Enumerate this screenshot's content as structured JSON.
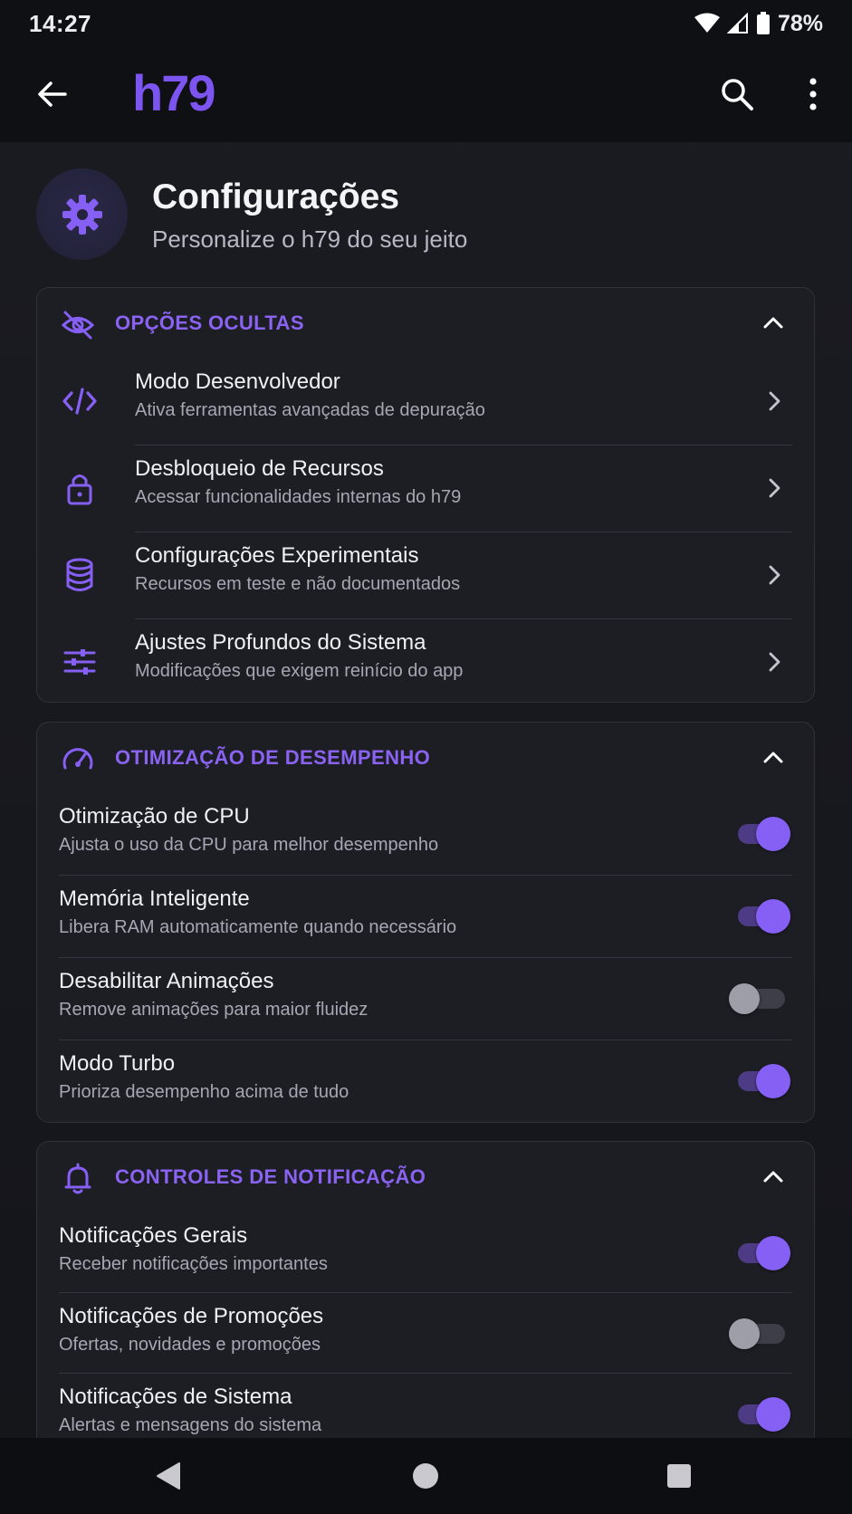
{
  "status": {
    "time": "14:27",
    "battery": "78%"
  },
  "appbar": {
    "logo": "h79"
  },
  "header": {
    "title": "Configurações",
    "subtitle": "Personalize o h79 do seu jeito"
  },
  "hidden_options": {
    "title": "OPÇÕES OCULTAS",
    "items": [
      {
        "label": "Modo Desenvolvedor",
        "desc": "Ativa ferramentas avançadas de depuração",
        "icon": "code-icon"
      },
      {
        "label": "Desbloqueio de Recursos",
        "desc": "Acessar funcionalidades internas do h79",
        "icon": "lock-icon"
      },
      {
        "label": "Configurações Experimentais",
        "desc": "Recursos em teste e não documentados",
        "icon": "database-icon"
      },
      {
        "label": "Ajustes Profundos do Sistema",
        "desc": "Modificações que exigem reinício do app",
        "icon": "sliders-icon"
      }
    ]
  },
  "performance": {
    "title": "OTIMIZAÇÃO DE DESEMPENHO",
    "items": [
      {
        "label": "Otimização de CPU",
        "desc": "Ajusta o uso da CPU para melhor desempenho",
        "on": true
      },
      {
        "label": "Memória Inteligente",
        "desc": "Libera RAM automaticamente quando necessário",
        "on": true
      },
      {
        "label": "Desabilitar Animações",
        "desc": "Remove animações para maior fluidez",
        "on": false
      },
      {
        "label": "Modo Turbo",
        "desc": "Prioriza desempenho acima de tudo",
        "on": true
      }
    ]
  },
  "notifications": {
    "title": "CONTROLES DE NOTIFICAÇÃO",
    "items": [
      {
        "label": "Notificações Gerais",
        "desc": "Receber notificações importantes",
        "on": true
      },
      {
        "label": "Notificações de Promoções",
        "desc": "Ofertas, novidades e promoções",
        "on": false
      },
      {
        "label": "Notificações de Sistema",
        "desc": "Alertas e mensagens do sistema",
        "on": true
      }
    ]
  },
  "colors": {
    "accent": "#8660f5",
    "background": "#17181d",
    "card": "#1d1e24"
  }
}
